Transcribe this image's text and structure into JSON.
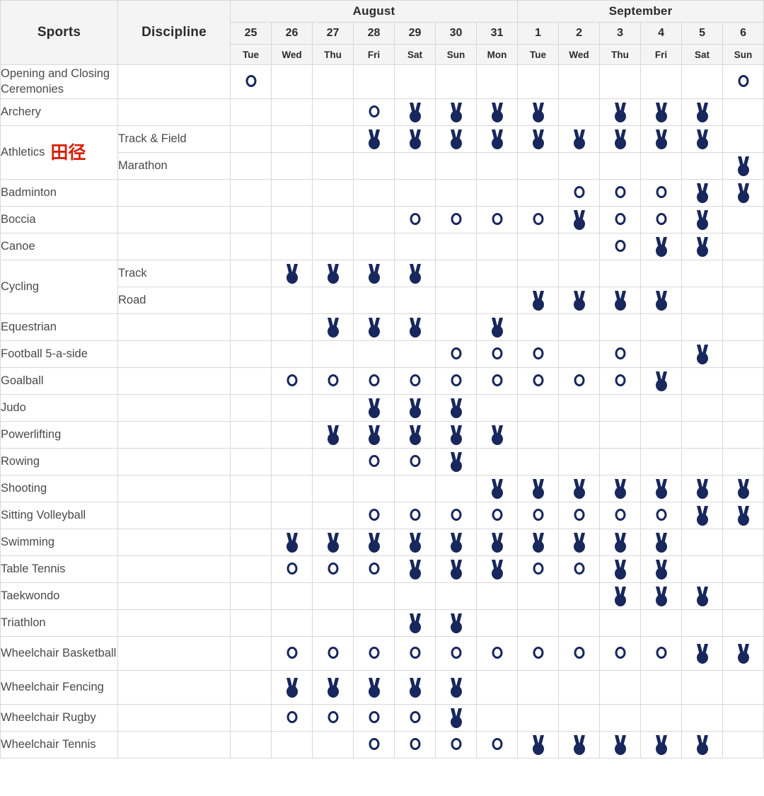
{
  "header": {
    "sports_label": "Sports",
    "discipline_label": "Discipline",
    "months": [
      {
        "name": "August",
        "span": 7
      },
      {
        "name": "September",
        "span": 6
      }
    ],
    "day_numbers": [
      "25",
      "26",
      "27",
      "28",
      "29",
      "30",
      "31",
      "1",
      "2",
      "3",
      "4",
      "5",
      "6"
    ],
    "day_names": [
      "Tue",
      "Wed",
      "Thu",
      "Fri",
      "Sat",
      "Sun",
      "Mon",
      "Tue",
      "Wed",
      "Thu",
      "Fri",
      "Sat",
      "Sun"
    ]
  },
  "legend": {
    "circle": "event-circle-icon",
    "medal": "medal-icon"
  },
  "colors": {
    "icon_navy": "#18275c",
    "header_bg": "#f4f4f5",
    "grid_line": "#d8d8dc",
    "chinese_red": "#d81e06",
    "text": "#4a4a4a"
  },
  "rows": [
    {
      "sport": "Opening and Closing Ceremonies",
      "sport_cn": "",
      "rowspan": 1,
      "discipline": "",
      "tall": true,
      "cells": [
        "circle",
        "",
        "",
        "",
        "",
        "",
        "",
        "",
        "",
        "",
        "",
        "",
        "circle"
      ]
    },
    {
      "sport": "Archery",
      "sport_cn": "",
      "rowspan": 1,
      "discipline": "",
      "cells": [
        "",
        "",
        "",
        "circle",
        "medal",
        "medal",
        "medal",
        "medal",
        "",
        "medal",
        "medal",
        "medal",
        ""
      ]
    },
    {
      "sport": "Athletics",
      "sport_cn": "田径",
      "rowspan": 2,
      "discipline": "Track & Field",
      "cells": [
        "",
        "",
        "",
        "medal",
        "medal",
        "medal",
        "medal",
        "medal",
        "medal",
        "medal",
        "medal",
        "medal",
        ""
      ]
    },
    {
      "sport": null,
      "sport_cn": "",
      "rowspan": 0,
      "discipline": "Marathon",
      "cells": [
        "",
        "",
        "",
        "",
        "",
        "",
        "",
        "",
        "",
        "",
        "",
        "",
        "medal"
      ]
    },
    {
      "sport": "Badminton",
      "sport_cn": "",
      "rowspan": 1,
      "discipline": "",
      "cells": [
        "",
        "",
        "",
        "",
        "",
        "",
        "",
        "",
        "circle",
        "circle",
        "circle",
        "medal",
        "medal"
      ]
    },
    {
      "sport": "Boccia",
      "sport_cn": "",
      "rowspan": 1,
      "discipline": "",
      "cells": [
        "",
        "",
        "",
        "",
        "circle",
        "circle",
        "circle",
        "circle",
        "medal",
        "circle",
        "circle",
        "medal",
        ""
      ]
    },
    {
      "sport": "Canoe",
      "sport_cn": "",
      "rowspan": 1,
      "discipline": "",
      "cells": [
        "",
        "",
        "",
        "",
        "",
        "",
        "",
        "",
        "",
        "circle",
        "medal",
        "medal",
        ""
      ]
    },
    {
      "sport": "Cycling",
      "sport_cn": "",
      "rowspan": 2,
      "discipline": "Track",
      "cells": [
        "",
        "medal",
        "medal",
        "medal",
        "medal",
        "",
        "",
        "",
        "",
        "",
        "",
        "",
        ""
      ]
    },
    {
      "sport": null,
      "sport_cn": "",
      "rowspan": 0,
      "discipline": "Road",
      "cells": [
        "",
        "",
        "",
        "",
        "",
        "",
        "",
        "medal",
        "medal",
        "medal",
        "medal",
        "",
        ""
      ]
    },
    {
      "sport": "Equestrian",
      "sport_cn": "",
      "rowspan": 1,
      "discipline": "",
      "cells": [
        "",
        "",
        "medal",
        "medal",
        "medal",
        "",
        "medal",
        "",
        "",
        "",
        "",
        "",
        ""
      ]
    },
    {
      "sport": "Football 5-a-side",
      "sport_cn": "",
      "rowspan": 1,
      "discipline": "",
      "cells": [
        "",
        "",
        "",
        "",
        "",
        "circle",
        "circle",
        "circle",
        "",
        "circle",
        "",
        "medal",
        ""
      ]
    },
    {
      "sport": "Goalball",
      "sport_cn": "",
      "rowspan": 1,
      "discipline": "",
      "cells": [
        "",
        "circle",
        "circle",
        "circle",
        "circle",
        "circle",
        "circle",
        "circle",
        "circle",
        "circle",
        "medal",
        "",
        ""
      ]
    },
    {
      "sport": "Judo",
      "sport_cn": "",
      "rowspan": 1,
      "discipline": "",
      "cells": [
        "",
        "",
        "",
        "medal",
        "medal",
        "medal",
        "",
        "",
        "",
        "",
        "",
        "",
        ""
      ]
    },
    {
      "sport": "Powerlifting",
      "sport_cn": "",
      "rowspan": 1,
      "discipline": "",
      "cells": [
        "",
        "",
        "medal",
        "medal",
        "medal",
        "medal",
        "medal",
        "",
        "",
        "",
        "",
        "",
        ""
      ]
    },
    {
      "sport": "Rowing",
      "sport_cn": "",
      "rowspan": 1,
      "discipline": "",
      "cells": [
        "",
        "",
        "",
        "circle",
        "circle",
        "medal",
        "",
        "",
        "",
        "",
        "",
        "",
        ""
      ]
    },
    {
      "sport": "Shooting",
      "sport_cn": "",
      "rowspan": 1,
      "discipline": "",
      "cells": [
        "",
        "",
        "",
        "",
        "",
        "",
        "medal",
        "medal",
        "medal",
        "medal",
        "medal",
        "medal",
        "medal"
      ]
    },
    {
      "sport": "Sitting Volleyball",
      "sport_cn": "",
      "rowspan": 1,
      "discipline": "",
      "cells": [
        "",
        "",
        "",
        "circle",
        "circle",
        "circle",
        "circle",
        "circle",
        "circle",
        "circle",
        "circle",
        "medal",
        "medal"
      ]
    },
    {
      "sport": "Swimming",
      "sport_cn": "",
      "rowspan": 1,
      "discipline": "",
      "cells": [
        "",
        "medal",
        "medal",
        "medal",
        "medal",
        "medal",
        "medal",
        "medal",
        "medal",
        "medal",
        "medal",
        "",
        ""
      ]
    },
    {
      "sport": "Table Tennis",
      "sport_cn": "",
      "rowspan": 1,
      "discipline": "",
      "cells": [
        "",
        "circle",
        "circle",
        "circle",
        "medal",
        "medal",
        "medal",
        "circle",
        "circle",
        "medal",
        "medal",
        "",
        ""
      ]
    },
    {
      "sport": "Taekwondo",
      "sport_cn": "",
      "rowspan": 1,
      "discipline": "",
      "cells": [
        "",
        "",
        "",
        "",
        "",
        "",
        "",
        "",
        "",
        "medal",
        "medal",
        "medal",
        ""
      ]
    },
    {
      "sport": "Triathlon",
      "sport_cn": "",
      "rowspan": 1,
      "discipline": "",
      "cells": [
        "",
        "",
        "",
        "",
        "medal",
        "medal",
        "",
        "",
        "",
        "",
        "",
        "",
        ""
      ]
    },
    {
      "sport": "Wheelchair Basketball",
      "sport_cn": "",
      "rowspan": 1,
      "discipline": "",
      "tall": true,
      "cells": [
        "",
        "circle",
        "circle",
        "circle",
        "circle",
        "circle",
        "circle",
        "circle",
        "circle",
        "circle",
        "circle",
        "medal",
        "medal"
      ]
    },
    {
      "sport": "Wheelchair Fencing",
      "sport_cn": "",
      "rowspan": 1,
      "discipline": "",
      "tall": true,
      "cells": [
        "",
        "medal",
        "medal",
        "medal",
        "medal",
        "medal",
        "",
        "",
        "",
        "",
        "",
        "",
        ""
      ]
    },
    {
      "sport": "Wheelchair Rugby",
      "sport_cn": "",
      "rowspan": 1,
      "discipline": "",
      "cells": [
        "",
        "circle",
        "circle",
        "circle",
        "circle",
        "medal",
        "",
        "",
        "",
        "",
        "",
        "",
        ""
      ]
    },
    {
      "sport": "Wheelchair Tennis",
      "sport_cn": "",
      "rowspan": 1,
      "discipline": "",
      "cells": [
        "",
        "",
        "",
        "circle",
        "circle",
        "circle",
        "circle",
        "medal",
        "medal",
        "medal",
        "medal",
        "medal",
        ""
      ]
    }
  ]
}
